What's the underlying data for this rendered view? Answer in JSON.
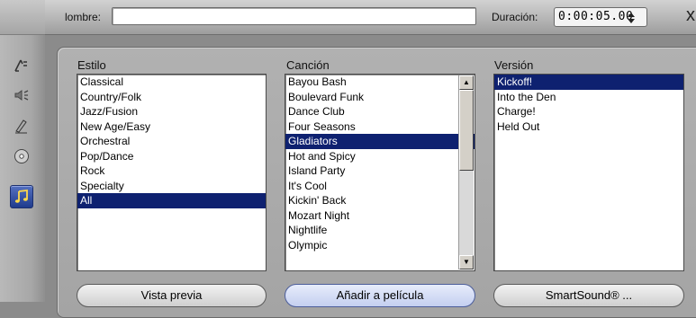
{
  "toolbar": {
    "tools": [
      {
        "icon": "video-edit-icon",
        "active": false
      },
      {
        "icon": "audio-speaker-icon",
        "active": false
      },
      {
        "icon": "pen-icon",
        "active": false
      },
      {
        "icon": "disc-icon",
        "active": false
      },
      {
        "icon": "music-note-icon",
        "active": true
      }
    ]
  },
  "header": {
    "name_label": "lombre:",
    "name_value": "",
    "duration_label": "Duración:",
    "duration_value": "0:00:05.00",
    "close_glyph": "x"
  },
  "columns": {
    "style_label": "Estilo",
    "song_label": "Canción",
    "version_label": "Versión"
  },
  "styles": [
    "Classical",
    "Country/Folk",
    "Jazz/Fusion",
    "New Age/Easy",
    "Orchestral",
    "Pop/Dance",
    "Rock",
    "Specialty",
    "All"
  ],
  "selected_style": "All",
  "songs": [
    "Bayou Bash",
    "Boulevard Funk",
    "Dance Club",
    "Four Seasons",
    "Gladiators",
    "Hot and Spicy",
    "Island Party",
    "It's Cool",
    "Kickin' Back",
    "Mozart Night",
    "Nightlife",
    "Olympic"
  ],
  "selected_song": "Gladiators",
  "versions": [
    "Kickoff!",
    "Into the Den",
    "Charge!",
    "Held Out"
  ],
  "selected_version": "Kickoff!",
  "buttons": {
    "preview": "Vista previa",
    "add_to_movie": "Añadir a película",
    "smartsound": "SmartSound® ..."
  },
  "colors": {
    "selection": "#0e2170",
    "active_tool": "#2a46a0"
  }
}
